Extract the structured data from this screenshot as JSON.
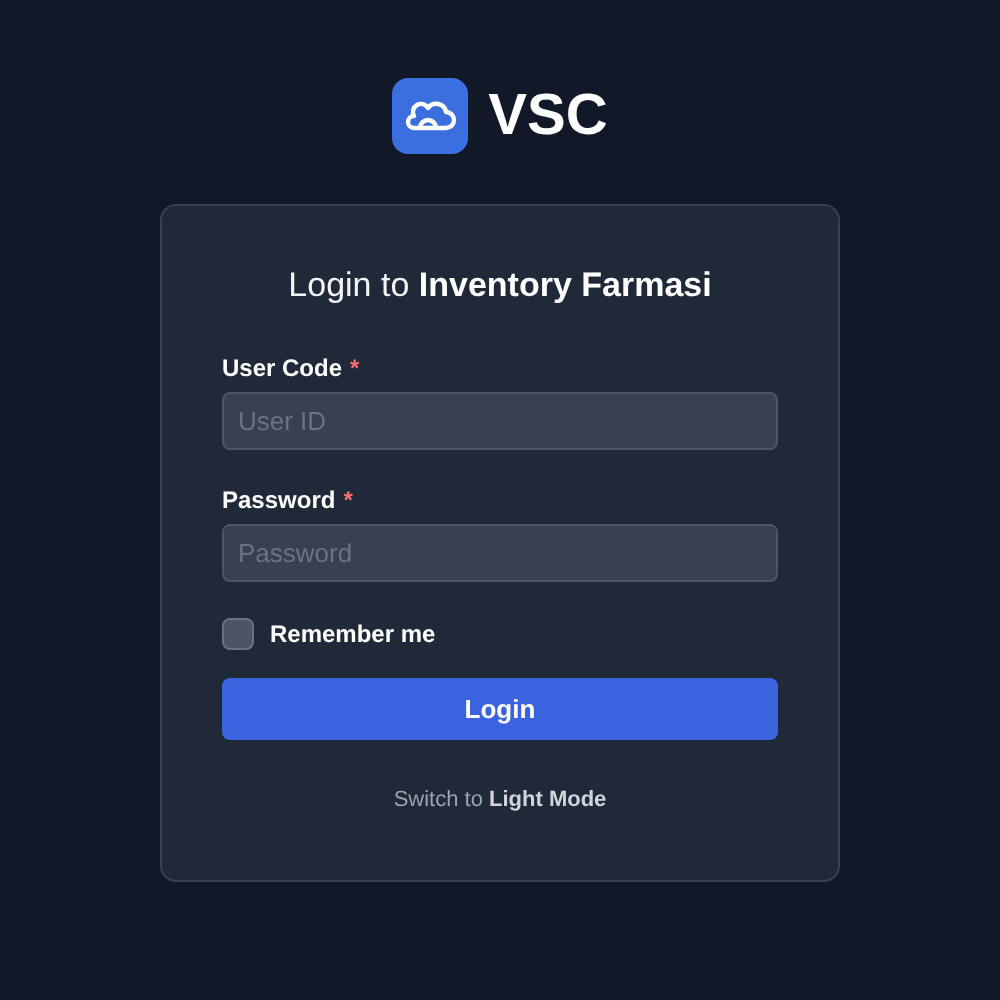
{
  "brand": {
    "name": "VSC"
  },
  "card": {
    "title": "Login to **Inventory Farmasi**",
    "fields": [
      {
        "label": "User Code",
        "required_mark": "*",
        "placeholder": "User ID"
      },
      {
        "label": "Password",
        "required_mark": "*",
        "placeholder": "Password"
      }
    ],
    "remember": {
      "label": "Remember me",
      "checked": false
    },
    "submit": "Login",
    "theme_switch": "Switch to **Light Mode**"
  }
}
